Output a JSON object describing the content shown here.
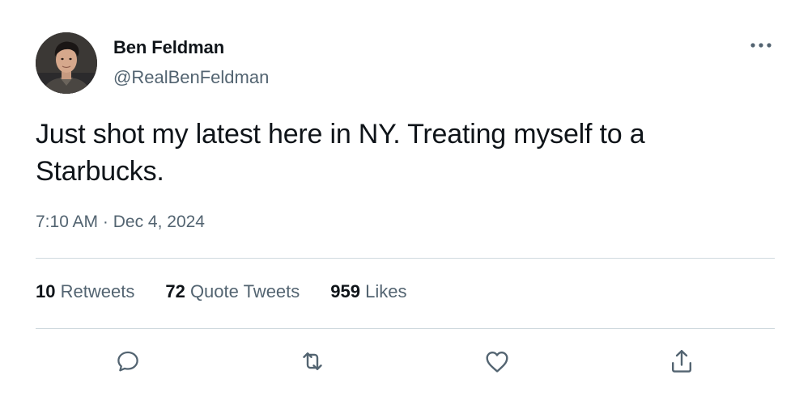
{
  "tweet": {
    "author": {
      "display_name": "Ben Feldman",
      "handle": "@RealBenFeldman",
      "avatar_icon": "profile-photo"
    },
    "text": "Just shot my latest here in NY. Treating myself to a Starbucks.",
    "time": "7:10 AM",
    "separator": " · ",
    "date": "Dec 4, 2024",
    "stats": {
      "retweets": {
        "count": "10",
        "label": "Retweets"
      },
      "quote_tweets": {
        "count": "72",
        "label": "Quote Tweets"
      },
      "likes": {
        "count": "959",
        "label": "Likes"
      }
    },
    "actions": [
      {
        "icon": "reply-icon"
      },
      {
        "icon": "retweet-icon"
      },
      {
        "icon": "like-icon"
      },
      {
        "icon": "share-icon"
      }
    ],
    "more_icon": "more-options-icon"
  },
  "colors": {
    "text_primary": "#0f1419",
    "text_secondary": "#536471",
    "divider": "#cfd9de"
  }
}
